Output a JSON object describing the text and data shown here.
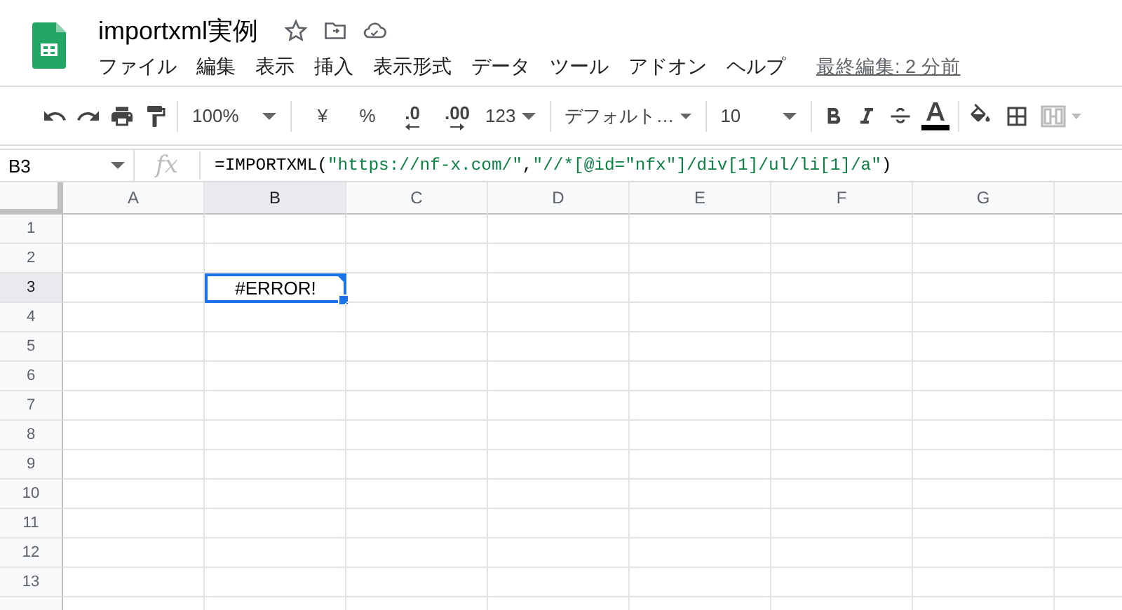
{
  "document": {
    "title": "importxml実例"
  },
  "menu": [
    {
      "label": "ファイル"
    },
    {
      "label": "編集"
    },
    {
      "label": "表示"
    },
    {
      "label": "挿入"
    },
    {
      "label": "表示形式"
    },
    {
      "label": "データ"
    },
    {
      "label": "ツール"
    },
    {
      "label": "アドオン"
    },
    {
      "label": "ヘルプ"
    }
  ],
  "last_edit": "最終編集: 2 分前",
  "toolbar": {
    "zoom": "100%",
    "currency": "¥",
    "percent": "%",
    "decrease_decimal": ".0",
    "increase_decimal": ".00",
    "number_format": "123",
    "font": "デフォルト…",
    "font_size": "10"
  },
  "formula_bar": {
    "name_box": "B3",
    "fx": "fx",
    "tokens": [
      {
        "kind": "plain",
        "text": "=IMPORTXML("
      },
      {
        "kind": "string",
        "text": "\"https://nf-x.com/\""
      },
      {
        "kind": "plain",
        "text": ","
      },
      {
        "kind": "string",
        "text": "\"//*[@id=\"nfx\"]/div[1]/ul/li[1]/a\""
      },
      {
        "kind": "plain",
        "text": ")"
      }
    ]
  },
  "columns": [
    {
      "label": "A",
      "selected": false
    },
    {
      "label": "B",
      "selected": true
    },
    {
      "label": "C",
      "selected": false
    },
    {
      "label": "D",
      "selected": false
    },
    {
      "label": "E",
      "selected": false
    },
    {
      "label": "F",
      "selected": false
    },
    {
      "label": "G",
      "selected": false
    },
    {
      "selected": false
    }
  ],
  "rows": [
    {
      "label": "1",
      "selected": false
    },
    {
      "label": "2",
      "selected": false
    },
    {
      "label": "3",
      "selected": true,
      "cells": [
        {
          "selected": false
        },
        {
          "text": "#ERROR!",
          "selected": true,
          "error": true
        }
      ]
    },
    {
      "label": "4",
      "selected": false
    },
    {
      "label": "5",
      "selected": false
    },
    {
      "label": "6",
      "selected": false
    },
    {
      "label": "7",
      "selected": false
    },
    {
      "label": "8",
      "selected": false
    },
    {
      "label": "9",
      "selected": false
    },
    {
      "label": "10",
      "selected": false
    },
    {
      "label": "11",
      "selected": false
    },
    {
      "label": "12",
      "selected": false
    },
    {
      "label": "13",
      "selected": false
    },
    {
      "selected": false
    }
  ]
}
